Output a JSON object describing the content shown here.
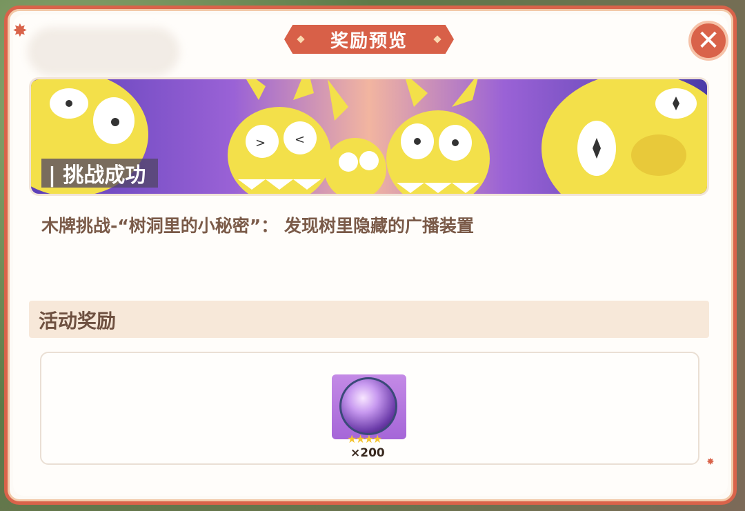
{
  "dialog": {
    "title": "奖励预览",
    "close_symbol": "✕"
  },
  "banner": {
    "tag": "| 挑战成功"
  },
  "description": "木牌挑战-“树洞里的小秘密”： 发现树里隐藏的广播装置",
  "rewards": {
    "section_title": "活动奖励",
    "items": [
      {
        "icon": "purple-crystal-orb-icon",
        "stars": "★★★★",
        "quantity": "×200"
      }
    ]
  },
  "colors": {
    "accent": "#d9634a",
    "section_bg": "#f7e8d9",
    "card_purple": "#a566d8"
  }
}
